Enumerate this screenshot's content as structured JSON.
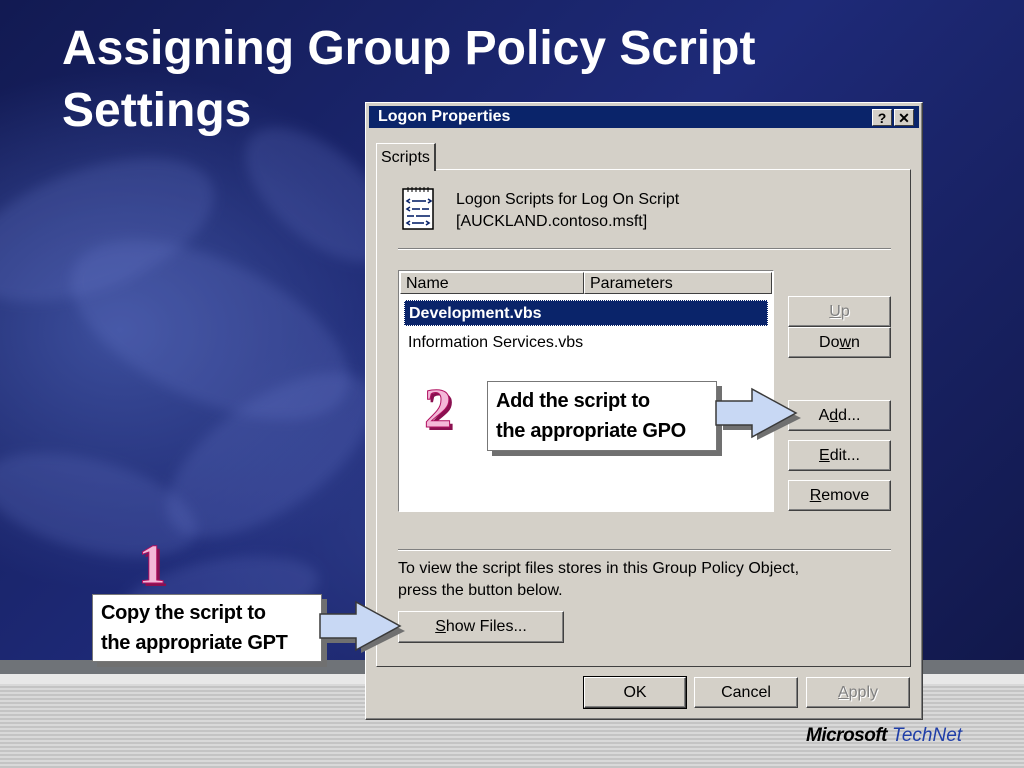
{
  "slide": {
    "title_line1": "Assigning Group Policy Script",
    "title_line2": "Settings",
    "logo_microsoft": "Microsoft",
    "logo_technet": "TechNet"
  },
  "dialog": {
    "title": "Logon Properties",
    "help_button": "?",
    "close_button": "✕",
    "tab": "Scripts",
    "header_line1": "Logon Scripts for Log On Script",
    "header_line2": "[AUCKLAND.contoso.msft]",
    "columns": [
      "Name",
      "Parameters"
    ],
    "scripts": [
      "Development.vbs",
      "Information Services.vbs"
    ],
    "selected_script": "Development.vbs",
    "buttons": {
      "up": "Up",
      "down": "Down",
      "add": "Add...",
      "edit": "Edit...",
      "remove": "Remove",
      "show_files": "Show Files...",
      "ok": "OK",
      "cancel": "Cancel",
      "apply": "Apply"
    },
    "info_line1": "To view the script files stores in this Group Policy Object,",
    "info_line2": "press the button below."
  },
  "callouts": [
    {
      "number": "1",
      "line1": "Copy the script to",
      "line2": " the appropriate GPT"
    },
    {
      "number": "2",
      "line1": "Add the script to",
      "line2": " the appropriate GPO"
    }
  ],
  "colors": {
    "titlebar": "#0a246a",
    "selection": "#0a246a",
    "dialog_face": "#d4d0c8",
    "callout_number_fill": "#f4b8d8",
    "callout_arrow": "#c8d8f4"
  }
}
